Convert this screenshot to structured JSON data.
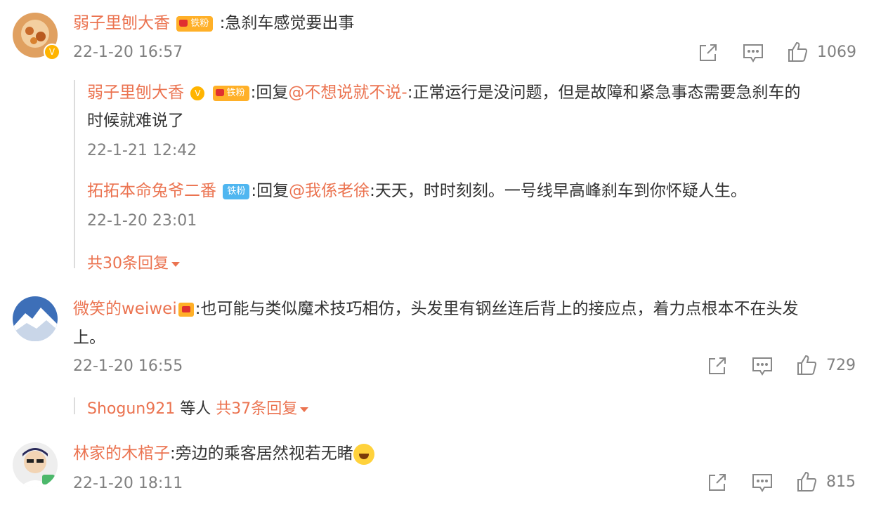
{
  "comments": [
    {
      "user": "弱子里刨大香",
      "badge": "铁粉",
      "text": ":急刹车感觉要出事",
      "time": "22-1-20 16:57",
      "likes": "1069",
      "replies": [
        {
          "user": "弱子里刨大香",
          "badge": "铁粉",
          "reply_prefix": ":回复",
          "mention": "@不想说就不说-",
          "text_line1": ":正常运行是没问题，但是故障和紧急事态需要急刹车的",
          "text_line2": "时候就难说了",
          "time": "22-1-21 12:42"
        },
        {
          "user": "拓拓本命兔爷二番",
          "badge": "铁粉",
          "reply_prefix": ":回复",
          "mention": "@我係老徐",
          "text": ":天天，时时刻刻。一号线早高峰刹车到你怀疑人生。",
          "time": "22-1-20 23:01"
        }
      ],
      "more_replies": "共30条回复"
    },
    {
      "user": "微笑的weiwei",
      "text_line1": ":也可能与类似魔术技巧相仿，头发里有钢丝连后背上的接应点，着力点根本不在头发",
      "text_line2": "上。",
      "time": "22-1-20 16:55",
      "likes": "729",
      "reply_user": "Shogun921",
      "reply_others": " 等人 ",
      "more_replies": "共37条回复"
    },
    {
      "user": "林家的木棺子",
      "text": ":旁边的乘客居然视若无睹",
      "time": "22-1-20 18:11",
      "likes": "815"
    }
  ],
  "icons": {
    "share": "share-icon",
    "comment": "comment-icon",
    "like": "like-icon"
  },
  "colors": {
    "name": "#eb7350",
    "meta": "#808080",
    "text": "#333333"
  }
}
